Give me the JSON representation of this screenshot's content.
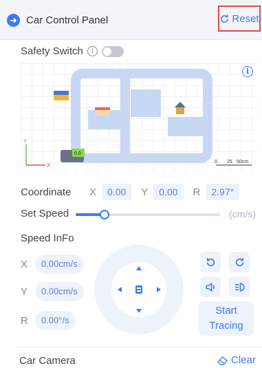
{
  "header": {
    "back_icon": "arrow-right-icon",
    "title": "Car Control Panel",
    "reset_label": "Reset",
    "reset_icon": "refresh-icon"
  },
  "safety": {
    "label": "Safety Switch",
    "enabled": false
  },
  "map": {
    "scale_labels": [
      "0",
      "25",
      "50cm"
    ],
    "car_label": "0.0",
    "axis_y": "Y",
    "axis_x": "X"
  },
  "coordinate": {
    "label": "Coordinate",
    "x_label": "X",
    "x": "0.00",
    "y_label": "Y",
    "y": "0.00",
    "r_label": "R",
    "r": "2.97°"
  },
  "speed": {
    "label": "Set Speed",
    "unit": "(cm/s)",
    "level": 0.2
  },
  "speed_info": {
    "title": "Speed InFo",
    "items": [
      {
        "axis": "X",
        "value": "0.00cm/s"
      },
      {
        "axis": "Y",
        "value": "0.00cm/s"
      },
      {
        "axis": "R",
        "value": "0.00°/s"
      }
    ]
  },
  "controls": {
    "icons": [
      "rotate-left-icon",
      "rotate-right-icon",
      "horn-icon",
      "headlight-icon"
    ],
    "tracing_line1": "Start",
    "tracing_line2": "Tracing"
  },
  "camera": {
    "label": "Car Camera",
    "clear_label": "Clear",
    "clear_icon": "eraser-icon"
  },
  "colors": {
    "accent": "#3d7bf5",
    "reset_border": "#e34848",
    "chip_bg": "#eef2fb"
  }
}
